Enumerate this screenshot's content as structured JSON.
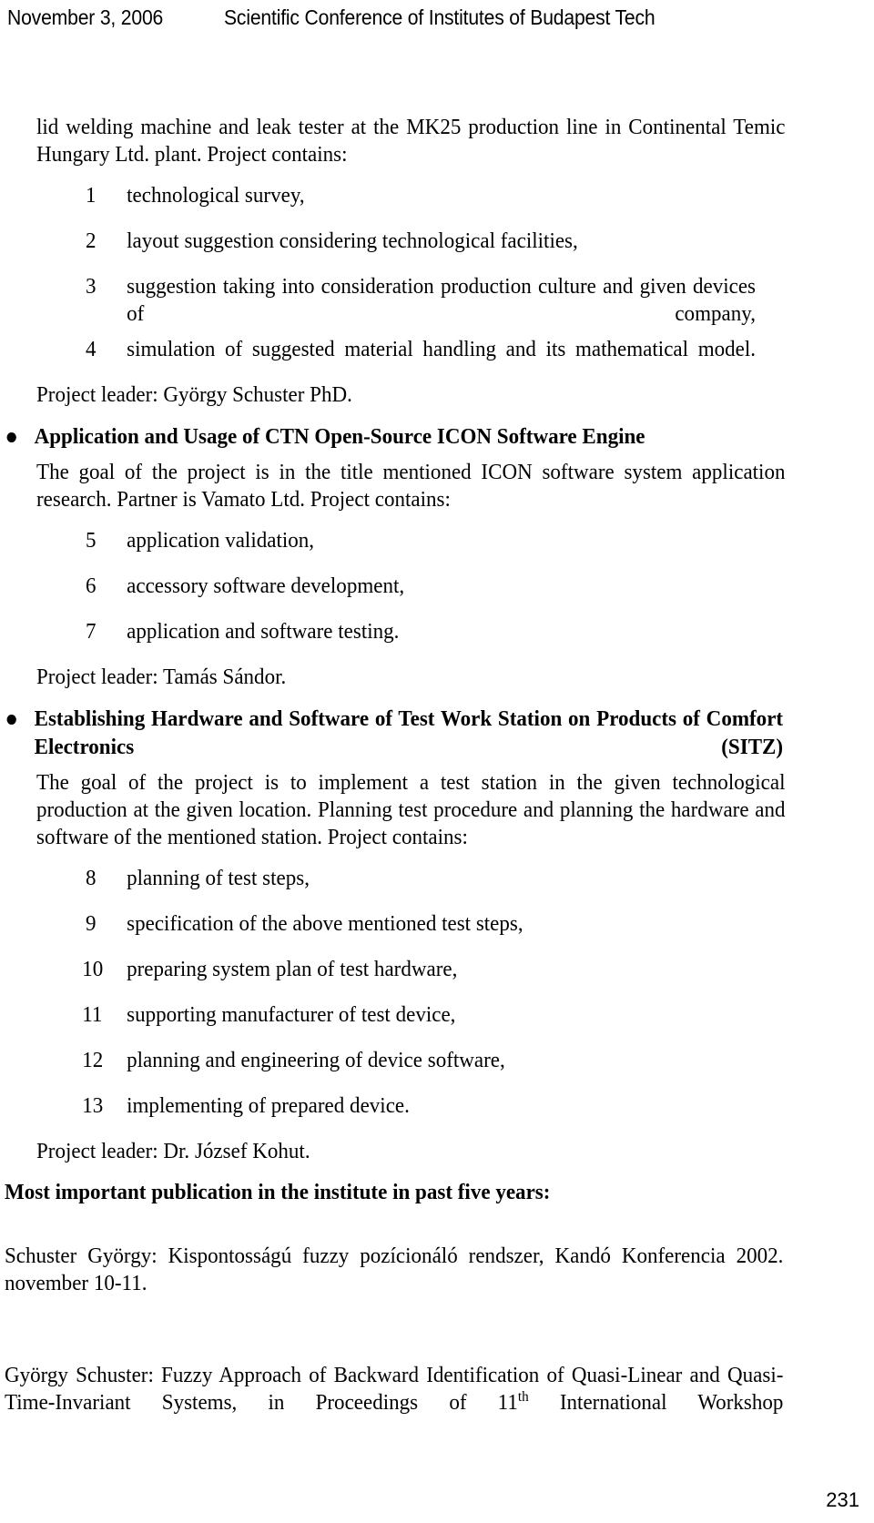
{
  "header": {
    "date": "November 3, 2006",
    "title": "Scientific Conference of Institutes of Budapest Tech"
  },
  "body": {
    "intro_paragraph": "lid welding machine and leak tester at the MK25 production line in Continental Temic Hungary Ltd. plant. Project contains:",
    "list_one": [
      {
        "num": "1",
        "text": "technological survey,"
      },
      {
        "num": "2",
        "text": "layout suggestion considering technological facilities,"
      },
      {
        "num": "3",
        "text": "suggestion taking into consideration production culture and given devices of company,"
      },
      {
        "num": "4",
        "text": "simulation of suggested material handling and its mathematical model."
      }
    ],
    "leader_one": "Project leader: György Schuster PhD.",
    "heading_two": "Application and Usage of CTN Open-Source ICON Software Engine",
    "paragraph_two": "The goal of the project is in the title mentioned ICON software system application research. Partner is Vamato Ltd. Project contains:",
    "list_two": [
      {
        "num": "5",
        "text": "application validation,"
      },
      {
        "num": "6",
        "text": "accessory software development,"
      },
      {
        "num": "7",
        "text": "application and software testing."
      }
    ],
    "leader_two": "Project leader: Tamás Sándor.",
    "heading_three": "Establishing Hardware and Software of Test Work Station on Products of Comfort Electronics (SITZ)",
    "paragraph_three": "The goal of the project is to implement a test station in the given technological production at the given location. Planning test procedure and planning the hardware and software of the mentioned station. Project contains:",
    "list_three": [
      {
        "num": "8",
        "text": "planning of test steps,"
      },
      {
        "num": "9",
        "text": "specification of the above mentioned test steps,"
      },
      {
        "num": "10",
        "text": "preparing system plan of test hardware,"
      },
      {
        "num": "11",
        "text": "supporting manufacturer of test device,"
      },
      {
        "num": "12",
        "text": "planning and engineering of device software,"
      },
      {
        "num": "13",
        "text": "implementing of prepared device."
      }
    ],
    "leader_three": "Project leader: Dr. József Kohut.",
    "publications_heading": "Most important publication in the institute in past five years:",
    "publication_one": "Schuster György: Kispontosságú fuzzy pozícionáló rendszer, Kandó Konferencia 2002. november 10-11.",
    "publication_two_part_a": "György Schuster: Fuzzy Approach of Backward Identification of Quasi-Linear and Quasi-Time-Invariant Systems, in Proceedings of 11",
    "publication_two_sup": "th",
    "publication_two_part_b": " International Workshop"
  },
  "footer": {
    "page_number": "231"
  }
}
